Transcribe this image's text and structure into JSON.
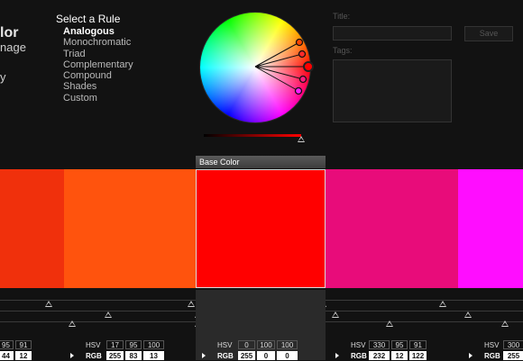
{
  "left_panel": {
    "line1": "lor",
    "line2": "nage",
    "line3": "y"
  },
  "rules": {
    "heading": "Select a Rule",
    "items": [
      {
        "label": "Analogous",
        "selected": true
      },
      {
        "label": "Monochromatic",
        "selected": false
      },
      {
        "label": "Triad",
        "selected": false
      },
      {
        "label": "Complementary",
        "selected": false
      },
      {
        "label": "Compound",
        "selected": false
      },
      {
        "label": "Shades",
        "selected": false
      },
      {
        "label": "Custom",
        "selected": false
      }
    ]
  },
  "form": {
    "title_label": "Title:",
    "tags_label": "Tags:",
    "save_label": "Save",
    "title_value": "",
    "tags_value": ""
  },
  "base_color_label": "Base Color",
  "swatches": [
    {
      "color": "#f0300c"
    },
    {
      "color": "#ff530d"
    },
    {
      "color": "#ff0000",
      "base": true
    },
    {
      "color": "#e80c7a"
    },
    {
      "color": "#ff0dff"
    }
  ],
  "values": {
    "col0": {
      "hsv": [
        "95",
        "91"
      ],
      "rgb": [
        "44",
        "12"
      ]
    },
    "col1": {
      "hsv": [
        "17",
        "95",
        "100"
      ],
      "rgb": [
        "255",
        "83",
        "13"
      ]
    },
    "col2": {
      "hsv": [
        "0",
        "100",
        "100"
      ],
      "rgb": [
        "255",
        "0",
        "0"
      ]
    },
    "col3": {
      "hsv": [
        "330",
        "95",
        "91"
      ],
      "rgb": [
        "232",
        "12",
        "122"
      ]
    },
    "col4": {
      "hsv": [
        "300"
      ],
      "rgb": [
        "255"
      ]
    },
    "hsv_label": "HSV",
    "rgb_label": "RGB"
  },
  "icons": {
    "colors": "color-wheel-icon",
    "play": "play-icon"
  }
}
